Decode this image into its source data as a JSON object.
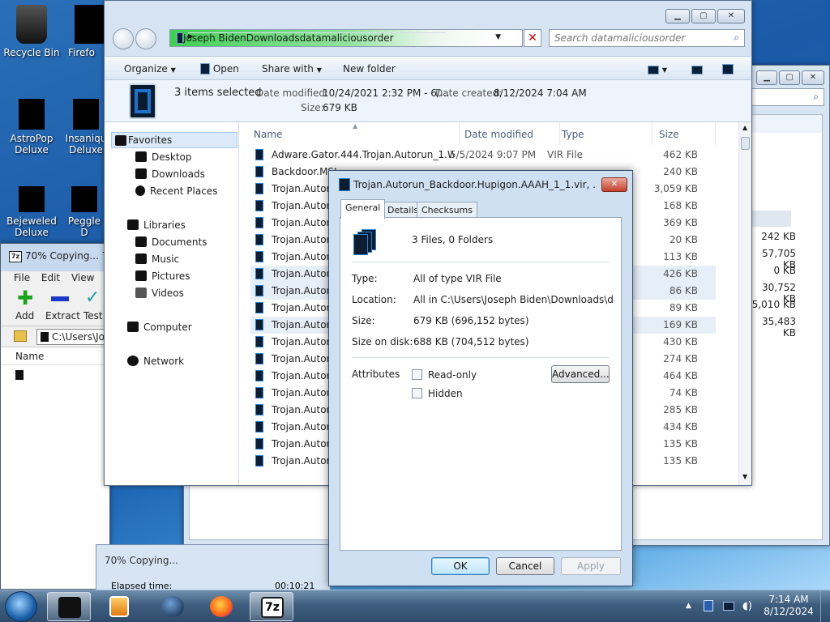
{
  "desktop": {
    "icons": [
      {
        "label": "Recycle Bin"
      },
      {
        "label": "Firefo"
      },
      {
        "label": "AstroPop Deluxe"
      },
      {
        "label": "Insaniqu Deluxe"
      },
      {
        "label": "Bejeweled Deluxe"
      },
      {
        "label": "Peggle D"
      }
    ]
  },
  "zip_window": {
    "title": "70% Copying... 7-2",
    "icon_text": "7z",
    "menu": "File Edit View F",
    "tools": [
      "Add",
      "Extract",
      "Test"
    ],
    "path": "C:\\Users\\Jo",
    "column": "Name"
  },
  "copying_window": {
    "title": "70% Copying...",
    "elapsed_label": "Elapsed time:",
    "elapsed_value": "00:10:21"
  },
  "right_window": {
    "sizes": [
      "242 KB",
      "57,705 KB",
      "0 KB",
      "30,752 KB",
      "5,010 KB",
      "35,483 KB"
    ]
  },
  "explorer": {
    "breadcrumbs": [
      "Joseph Biden",
      "Downloads",
      "datamaliciousorder"
    ],
    "search_placeholder": "Search datamaliciousorder",
    "commands": {
      "organize": "Organize",
      "open": "Open",
      "share": "Share with",
      "new_folder": "New folder"
    },
    "details": {
      "selected": "3 items selected",
      "modified_label": "Date modified:",
      "modified_value": "10/24/2021 2:32 PM - 6/...",
      "created_label": "Date created:",
      "created_value": "8/12/2024 7:04 AM",
      "size_label": "Size:",
      "size_value": "679 KB"
    },
    "nav": {
      "favorites": "Favorites",
      "desktop": "Desktop",
      "downloads": "Downloads",
      "recent": "Recent Places",
      "libraries": "Libraries",
      "documents": "Documents",
      "music": "Music",
      "pictures": "Pictures",
      "videos": "Videos",
      "computer": "Computer",
      "network": "Network"
    },
    "columns": {
      "name": "Name",
      "date": "Date modified",
      "type": "Type",
      "size": "Size"
    },
    "files": [
      {
        "name": "Adware.Gator.444.Trojan.Autorun_1.Wor...",
        "date": "5/5/2024 9:07 PM",
        "type": "VIR File",
        "size": "462 KB"
      },
      {
        "name": "Backdoor.MSI",
        "date": "",
        "type": "",
        "size": "240 KB"
      },
      {
        "name": "Trojan.Autorun",
        "date": "",
        "type": "",
        "size": "3,059 KB"
      },
      {
        "name": "Trojan.Autorun",
        "date": "",
        "type": "",
        "size": "168 KB"
      },
      {
        "name": "Trojan.Autorun",
        "date": "",
        "type": "",
        "size": "369 KB"
      },
      {
        "name": "Trojan.Autorun",
        "date": "",
        "type": "",
        "size": "20 KB"
      },
      {
        "name": "Trojan.Autorun",
        "date": "",
        "type": "",
        "size": "113 KB"
      },
      {
        "name": "Trojan.Autorun",
        "date": "",
        "type": "",
        "size": "426 KB"
      },
      {
        "name": "Trojan.Autorun",
        "date": "",
        "type": "",
        "size": "86 KB"
      },
      {
        "name": "Trojan.Autorun",
        "date": "",
        "type": "",
        "size": "89 KB"
      },
      {
        "name": "Trojan.Autorun",
        "date": "",
        "type": "",
        "size": "169 KB"
      },
      {
        "name": "Trojan.Autorun",
        "date": "",
        "type": "",
        "size": "430 KB"
      },
      {
        "name": "Trojan.Autorun",
        "date": "",
        "type": "",
        "size": "274 KB"
      },
      {
        "name": "Trojan.Autorun",
        "date": "",
        "type": "",
        "size": "464 KB"
      },
      {
        "name": "Trojan.Autorun",
        "date": "",
        "type": "",
        "size": "74 KB"
      },
      {
        "name": "Trojan.Autorun",
        "date": "",
        "type": "",
        "size": "285 KB"
      },
      {
        "name": "Trojan.Autorun",
        "date": "",
        "type": "",
        "size": "434 KB"
      },
      {
        "name": "Trojan.Autorun",
        "date": "",
        "type": "",
        "size": "135 KB"
      },
      {
        "name": "Trojan.Autorun",
        "date": "",
        "type": "",
        "size": "135 KB"
      }
    ]
  },
  "properties": {
    "title": "Trojan.Autorun_Backdoor.Hupigon.AAAH_1_1.vir, ... Pr...",
    "tabs": [
      "General",
      "Details",
      "Checksums"
    ],
    "summary": "3 Files, 0 Folders",
    "type_label": "Type:",
    "type_value": "All of type VIR File",
    "location_label": "Location:",
    "location_value": "All in C:\\Users\\Joseph Biden\\Downloads\\datamalicio",
    "size_label": "Size:",
    "size_value": "679 KB (696,152 bytes)",
    "disk_label": "Size on disk:",
    "disk_value": "688 KB (704,512 bytes)",
    "attributes_label": "Attributes",
    "readonly_label": "Read-only",
    "hidden_label": "Hidden",
    "advanced_label": "Advanced...",
    "ok_label": "OK",
    "cancel_label": "Cancel",
    "apply_label": "Apply"
  },
  "taskbar": {
    "zip_label": "7z",
    "time": "7:14 AM",
    "date": "8/12/2024"
  }
}
